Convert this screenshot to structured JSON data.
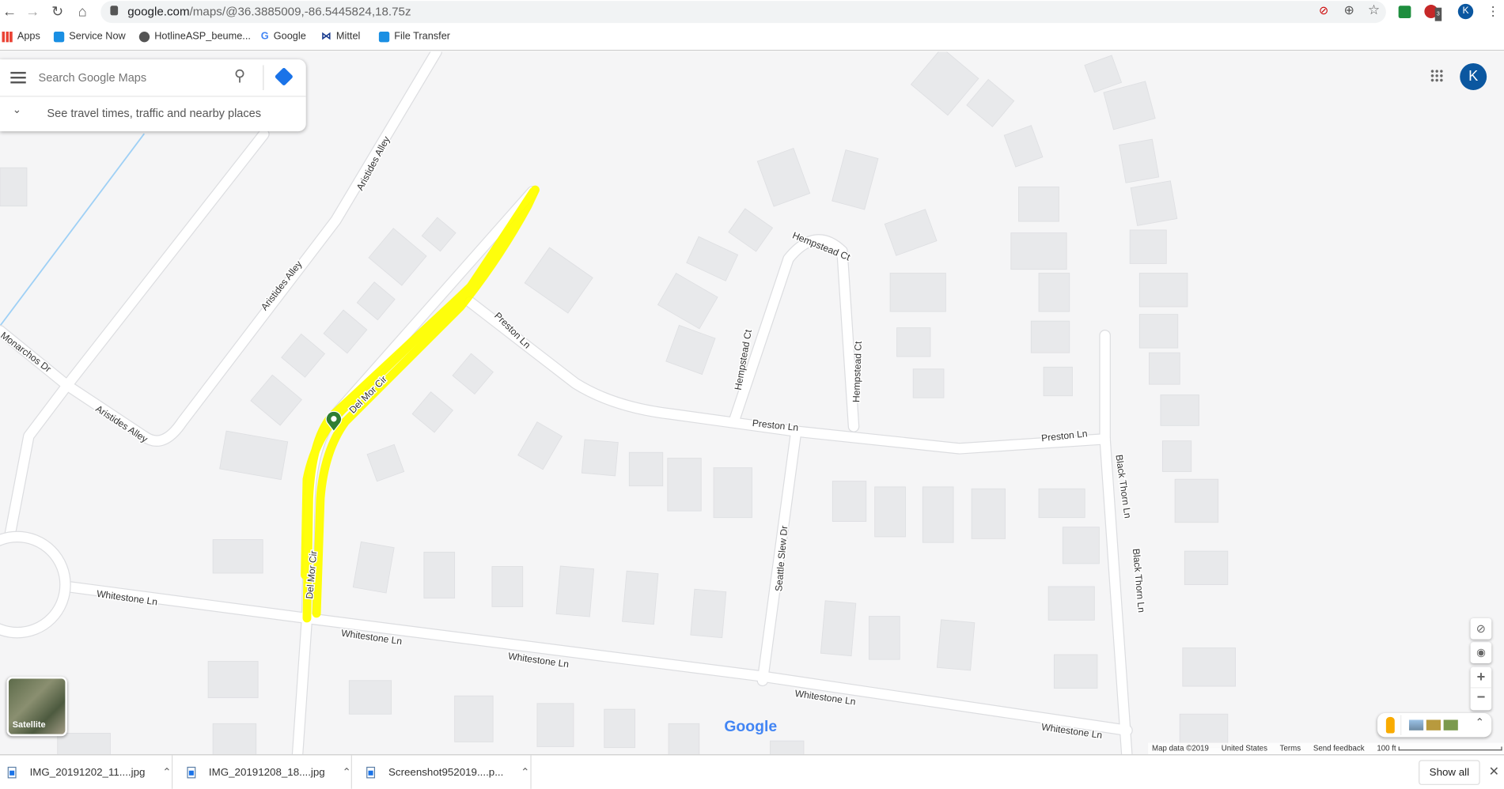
{
  "browser": {
    "url_host": "google.com",
    "url_path": "/maps/@36.3885009,-86.5445824,18.75z",
    "bookmarks": [
      {
        "label": "Apps",
        "icon": "apps-grid-icon"
      },
      {
        "label": "Service Now",
        "icon": "b-icon"
      },
      {
        "label": "HotlineASP_beume...",
        "icon": "globe-icon"
      },
      {
        "label": "Google",
        "icon": "google-g-icon"
      },
      {
        "label": "Mittel",
        "icon": "mittel-icon"
      },
      {
        "label": "File Transfer",
        "icon": "b-icon"
      }
    ],
    "profile_initial": "K",
    "extension_badge": "3"
  },
  "search": {
    "placeholder": "Search Google Maps",
    "hint": "See travel times, traffic and nearby places"
  },
  "account": {
    "initial": "K",
    "color": "#0b57a0"
  },
  "map": {
    "highlight_color": "#ffff00",
    "pin_color": "#2e7d32",
    "labels": [
      "Aristides Alley",
      "Aristides Alley",
      "Monarchos Dr",
      "Aristides Alley",
      "Preston Ln",
      "Del Mor Cir",
      "Del Mor Cir",
      "Hempstead Ct",
      "Hempstead Ct",
      "Hempstead Ct",
      "Preston Ln",
      "Preston Ln",
      "Black Thorn Ln",
      "Black Thorn Ln",
      "Seattle Slew Dr",
      "Whitestone Ln",
      "Whitestone Ln",
      "Whitestone Ln",
      "Whitestone Ln",
      "Whitestone Ln"
    ],
    "satellite_label": "Satellite",
    "logo": "Google"
  },
  "footer": {
    "map_data": "Map data ©2019",
    "region": "United States",
    "terms": "Terms",
    "feedback": "Send feedback",
    "scale": "100 ft"
  },
  "downloads": {
    "items": [
      "IMG_20191202_11....jpg",
      "IMG_20191208_18....jpg",
      "Screenshot952019....p..."
    ],
    "show_all": "Show all"
  }
}
